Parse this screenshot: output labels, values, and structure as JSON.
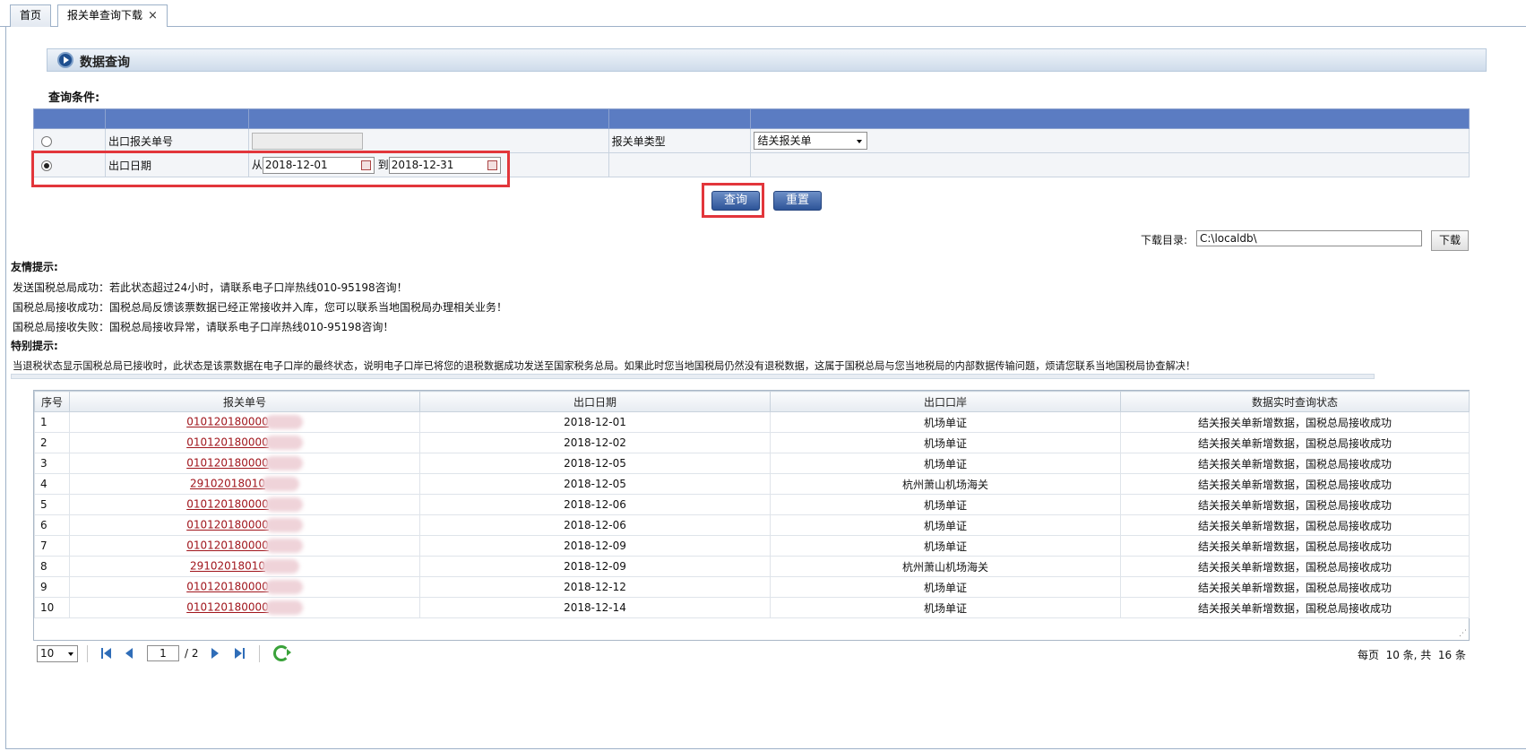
{
  "tabs": [
    {
      "label": "首页"
    },
    {
      "label": "报关单查询下载",
      "close": "×"
    }
  ],
  "section": {
    "title": "数据查询"
  },
  "query": {
    "title": "查询条件:",
    "row1": {
      "label": "出口报关单号",
      "type_label": "报关单类型",
      "type_value": "结关报关单"
    },
    "row2": {
      "label": "出口日期",
      "from_label": "从",
      "from_value": "2018-12-01",
      "to_label": "到",
      "to_value": "2018-12-31"
    },
    "selected_option": "出口日期"
  },
  "buttons": {
    "search": "查询",
    "reset": "重置",
    "download": "下载"
  },
  "download": {
    "label": "下载目录:",
    "path": "C:\\localdb\\"
  },
  "tips": {
    "friendly_title": "友情提示:",
    "lines": [
      "发送国税总局成功：若此状态超过24小时，请联系电子口岸热线010-95198咨询！",
      "国税总局接收成功：国税总局反馈该票数据已经正常接收并入库，您可以联系当地国税局办理相关业务！",
      "国税总局接收失败：国税总局接收异常，请联系电子口岸热线010-95198咨询！"
    ],
    "special_title": "特别提示:",
    "special_text": "当退税状态显示国税总局已接收时，此状态是该票数据在电子口岸的最终状态，说明电子口岸已将您的退税数据成功发送至国家税务总局。如果此时您当地国税局仍然没有退税数据，这属于国税总局与您当地税局的内部数据传输问题，烦请您联系当地国税局协查解决！"
  },
  "grid": {
    "columns": [
      "序号",
      "报关单号",
      "出口日期",
      "出口口岸",
      "数据实时查询状态"
    ],
    "rows": [
      {
        "no": "1",
        "id": "010120180000",
        "date": "2018-12-01",
        "port": "机场单证",
        "status": "结关报关单新增数据，国税总局接收成功"
      },
      {
        "no": "2",
        "id": "010120180000",
        "date": "2018-12-02",
        "port": "机场单证",
        "status": "结关报关单新增数据，国税总局接收成功"
      },
      {
        "no": "3",
        "id": "010120180000",
        "date": "2018-12-05",
        "port": "机场单证",
        "status": "结关报关单新增数据，国税总局接收成功"
      },
      {
        "no": "4",
        "id": "29102018010",
        "date": "2018-12-05",
        "port": "杭州萧山机场海关",
        "status": "结关报关单新增数据，国税总局接收成功"
      },
      {
        "no": "5",
        "id": "010120180000",
        "date": "2018-12-06",
        "port": "机场单证",
        "status": "结关报关单新增数据，国税总局接收成功"
      },
      {
        "no": "6",
        "id": "010120180000",
        "date": "2018-12-06",
        "port": "机场单证",
        "status": "结关报关单新增数据，国税总局接收成功"
      },
      {
        "no": "7",
        "id": "010120180000",
        "date": "2018-12-09",
        "port": "机场单证",
        "status": "结关报关单新增数据，国税总局接收成功"
      },
      {
        "no": "8",
        "id": "29102018010",
        "date": "2018-12-09",
        "port": "杭州萧山机场海关",
        "status": "结关报关单新增数据，国税总局接收成功"
      },
      {
        "no": "9",
        "id": "010120180000",
        "date": "2018-12-12",
        "port": "机场单证",
        "status": "结关报关单新增数据，国税总局接收成功"
      },
      {
        "no": "10",
        "id": "010120180000",
        "date": "2018-12-14",
        "port": "机场单证",
        "status": "结关报关单新增数据，国税总局接收成功"
      }
    ]
  },
  "pager": {
    "page_size": "10",
    "current_page": "1",
    "total_pages": "/ 2",
    "summary": "每页  10 条, 共  16 条"
  },
  "colors": {
    "highlight": "#e2363b",
    "header_band": "#5b7cc2",
    "button": "#2d5498",
    "link": "#a0151c"
  }
}
